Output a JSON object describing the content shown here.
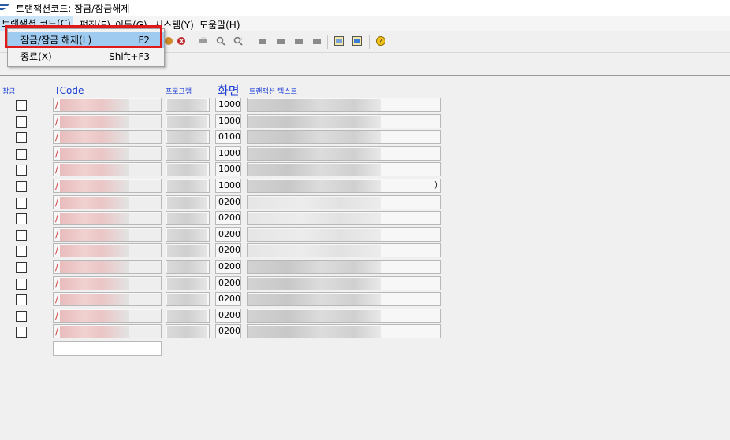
{
  "window": {
    "title": "트랜잭션코드: 잠금/잠금해제"
  },
  "menubar": {
    "items": [
      {
        "label": "트랜잭션 코드(C)",
        "active": true
      },
      {
        "label": "편집(E)"
      },
      {
        "label": "이동(G)"
      },
      {
        "label": "시스템(Y)"
      },
      {
        "label": "도움말(H)"
      }
    ]
  },
  "toolbar": {
    "icons": [
      "execute-icon",
      "cancel-icon",
      "print-icon",
      "find-icon",
      "find-next-icon",
      "first-page-icon",
      "previous-page-icon",
      "next-page-icon",
      "last-page-icon",
      "create-session-icon",
      "shortcut-icon",
      "help-icon"
    ]
  },
  "dropdown": {
    "items": [
      {
        "label": "잠금/잠금 해제(L)",
        "shortcut": "F2"
      },
      {
        "label": "종료(X)",
        "shortcut": "Shift+F3"
      }
    ]
  },
  "table": {
    "headers": {
      "lock": "잠금",
      "tcode": "TCode",
      "program": "프로그램",
      "screen": "화면",
      "text": "트랜잭션 텍스트"
    },
    "rows": [
      {
        "tcode": "/",
        "screen": "1000",
        "text_tail": ""
      },
      {
        "tcode": "/",
        "screen": "1000",
        "text_tail": ""
      },
      {
        "tcode": "/",
        "screen": "0100",
        "text_tail": ""
      },
      {
        "tcode": "/",
        "screen": "1000",
        "text_tail": ""
      },
      {
        "tcode": "/",
        "screen": "1000",
        "text_tail": ""
      },
      {
        "tcode": "/",
        "screen": "1000",
        "text_tail": ")"
      },
      {
        "tcode": "/",
        "screen": "0200",
        "text_tail": ""
      },
      {
        "tcode": "/",
        "screen": "0200",
        "text_tail": ""
      },
      {
        "tcode": "/",
        "screen": "0200",
        "text_tail": ""
      },
      {
        "tcode": "/",
        "screen": "0200",
        "text_tail": ""
      },
      {
        "tcode": "/",
        "screen": "0200",
        "text_tail": ""
      },
      {
        "tcode": "/",
        "screen": "0200",
        "text_tail": ""
      },
      {
        "tcode": "/",
        "screen": "0200",
        "text_tail": ""
      },
      {
        "tcode": "/",
        "screen": "0200",
        "text_tail": ""
      },
      {
        "tcode": "/",
        "screen": "0200",
        "text_tail": ""
      }
    ]
  },
  "colors": {
    "header_text": "#1f3fd6",
    "selection": "#9ecbef",
    "highlight_border": "#e01a1a"
  }
}
